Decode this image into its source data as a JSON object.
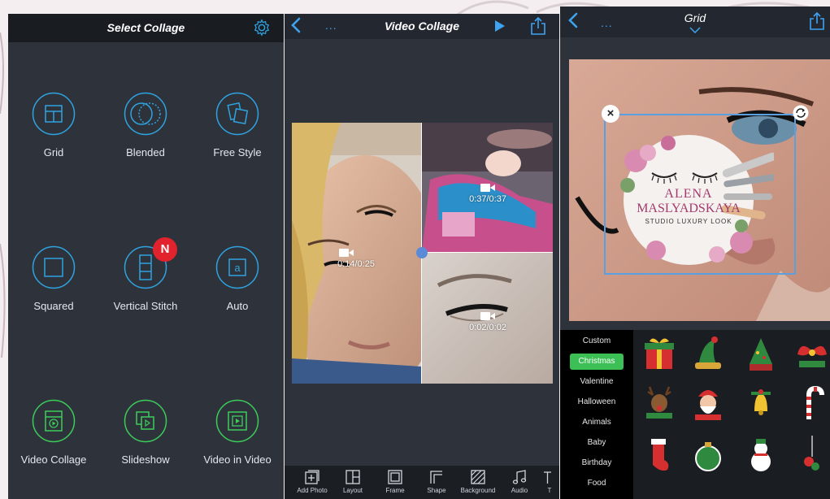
{
  "panel1": {
    "title": "Select Collage",
    "settings_icon": "gear-icon",
    "badge": "N",
    "options": [
      {
        "label": "Grid",
        "icon": "grid-icon",
        "color": "#2fa3e0"
      },
      {
        "label": "Blended",
        "icon": "blended-icon",
        "color": "#2fa3e0"
      },
      {
        "label": "Free Style",
        "icon": "free-style-icon",
        "color": "#2fa3e0"
      },
      {
        "label": "Squared",
        "icon": "squared-icon",
        "color": "#2fa3e0"
      },
      {
        "label": "Vertical Stitch",
        "icon": "vertical-stitch-icon",
        "color": "#2fa3e0"
      },
      {
        "label": "Auto",
        "icon": "auto-icon",
        "color": "#2fa3e0"
      },
      {
        "label": "Video Collage",
        "icon": "video-collage-icon",
        "color": "#3ccc5a"
      },
      {
        "label": "Slideshow",
        "icon": "slideshow-icon",
        "color": "#3ccc5a"
      },
      {
        "label": "Video in Video",
        "icon": "video-in-video-icon",
        "color": "#3ccc5a"
      }
    ]
  },
  "panel2": {
    "dots": "...",
    "title": "Video Collage",
    "cells": [
      {
        "time": "0:14/0:25"
      },
      {
        "time": "0:37/0:37"
      },
      {
        "time": "0:02/0:02"
      }
    ],
    "toolbar": [
      "Add Photo",
      "Layout",
      "Frame",
      "Shape",
      "Background",
      "Audio",
      "T"
    ]
  },
  "panel3": {
    "dots": "...",
    "title": "Grid",
    "logo": {
      "line1": "ALENA",
      "line2": "MASLYADSKAYA",
      "line3": "STUDIO LUXURY LOOK"
    },
    "categories": [
      "Custom",
      "Christmas",
      "Valentine",
      "Halloween",
      "Animals",
      "Baby",
      "Birthday",
      "Food"
    ],
    "selected_category": "Christmas"
  },
  "colors": {
    "accent_blue": "#2fa3e0",
    "accent_green": "#3ccc5a",
    "badge_red": "#e0232c",
    "panel_bg": "#2e333b"
  }
}
